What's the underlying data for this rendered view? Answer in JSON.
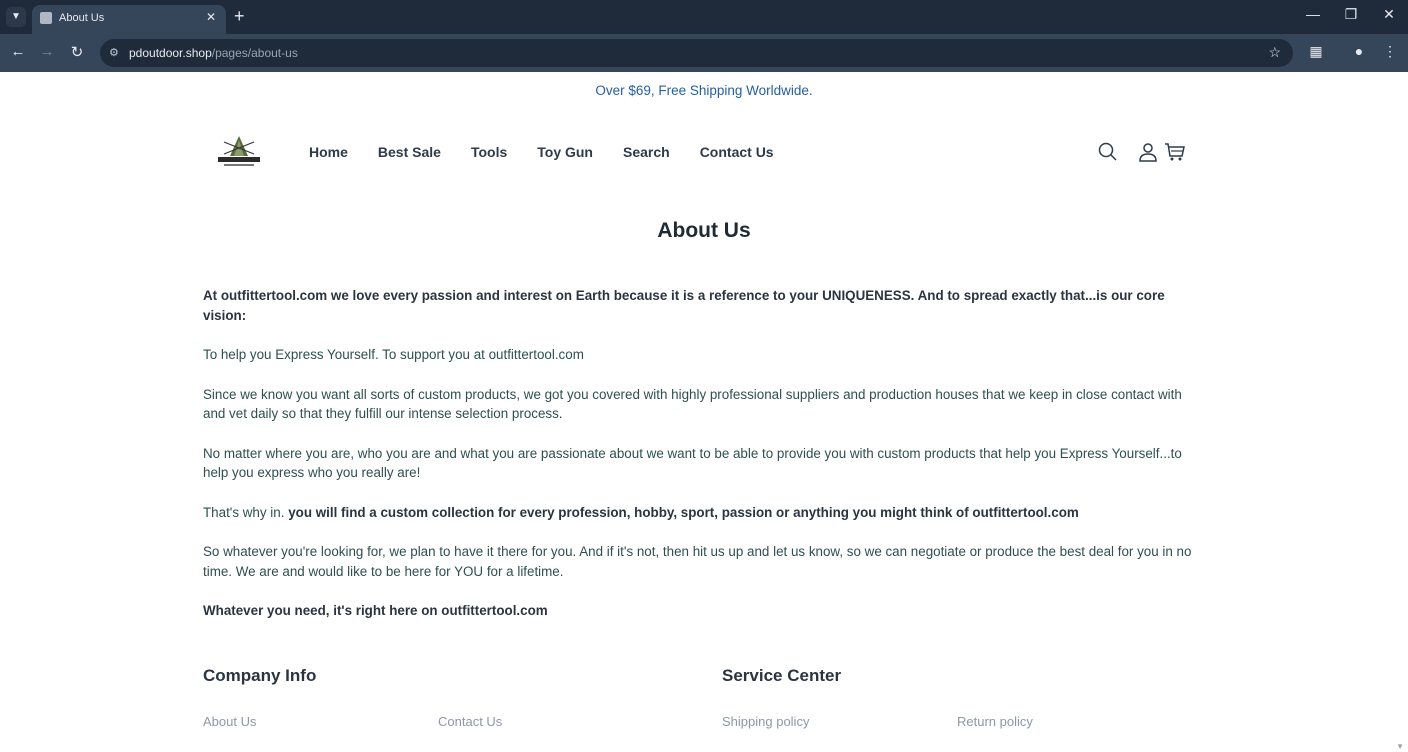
{
  "browser": {
    "tab_title": "About Us",
    "url_domain": "pdoutdoor.shop",
    "url_path": "/pages/about-us"
  },
  "store": {
    "announcement": "Over $69, Free Shipping Worldwide.",
    "logo_text": "OUTFITTERTOOL",
    "nav": [
      "Home",
      "Best Sale",
      "Tools",
      "Toy Gun",
      "Search",
      "Contact Us"
    ]
  },
  "about": {
    "title": "About Us",
    "p1": "At outfittertool.com we love every passion and interest on Earth because it is a reference to your UNIQUENESS. And to spread exactly that...is our core vision:",
    "p2": "To help you Express Yourself. To support you at outfittertool.com",
    "p3": "Since we know you want all sorts of custom products, we got you covered with highly professional suppliers and production houses that we keep in close contact with and vet daily so that they fulfill our intense selection process.",
    "p4": "No matter where you are, who you are and what you are passionate about we want to be able to provide you with custom products that help you Express Yourself...to help you express who you really are!",
    "p5_prefix": "That's why in.",
    "p5_bold": "you will find a custom collection for every profession, hobby, sport, passion or anything you might think of outfittertool.com",
    "p6": "So whatever you're looking for, we plan to have it there for you. And if it's not, then hit us up and let us know, so we can negotiate or produce the best deal for you in no time. We are and would like to be here for YOU for a lifetime.",
    "p7": "Whatever you need, it's right here on outfittertool.com"
  },
  "footer": {
    "company_title": "Company Info",
    "service_title": "Service Center",
    "company_links": [
      "About Us",
      "Contact Us"
    ],
    "service_links": [
      "Shipping policy",
      "Return policy"
    ]
  },
  "icons": [
    "search-icon",
    "account-icon",
    "cart-icon"
  ]
}
